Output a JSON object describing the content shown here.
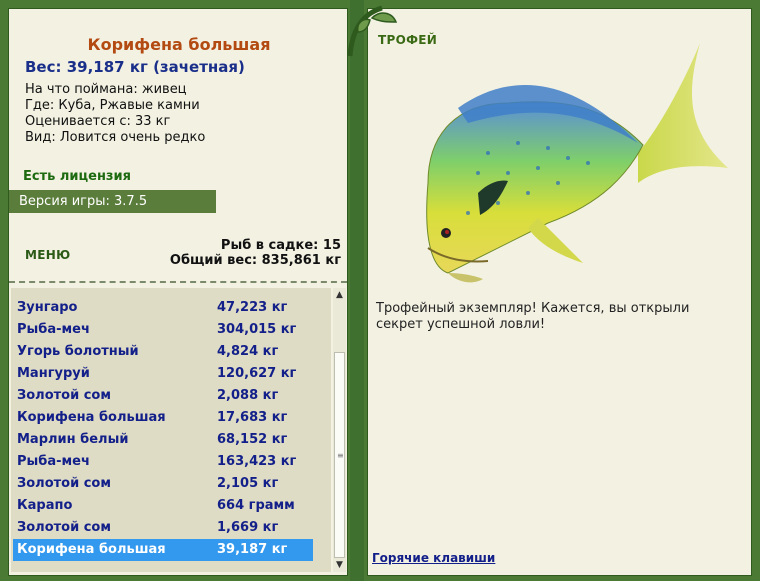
{
  "fish": {
    "title": "Корифена большая",
    "weight_line": "Вес: 39,187 кг (зачетная)",
    "bait": "На что поймана: живец",
    "location": "Где: Куба, Ржавые камни",
    "valued_from": "Оценивается с: 33 кг",
    "kind": "Вид: Ловится очень редко"
  },
  "license": "Есть лицензия",
  "version": "Версия игры: 3.7.5",
  "menu_label": "МЕНЮ",
  "stats": {
    "fish_in_cage": "Рыб в садке: 15",
    "total_weight": "Общий вес: 835,861 кг"
  },
  "catch_list": [
    {
      "name": "Зунгаро",
      "weight": "47,223 кг"
    },
    {
      "name": "Рыба-меч",
      "weight": "304,015 кг"
    },
    {
      "name": "Угорь болотный",
      "weight": "4,824 кг"
    },
    {
      "name": "Мангуруй",
      "weight": "120,627 кг"
    },
    {
      "name": "Золотой сом",
      "weight": "2,088 кг"
    },
    {
      "name": "Корифена большая",
      "weight": "17,683 кг"
    },
    {
      "name": "Марлин белый",
      "weight": "68,152 кг"
    },
    {
      "name": "Рыба-меч",
      "weight": "163,423 кг"
    },
    {
      "name": "Золотой сом",
      "weight": "2,105 кг"
    },
    {
      "name": "Карапо",
      "weight": "664 грамм"
    },
    {
      "name": "Золотой сом",
      "weight": "1,669 кг"
    },
    {
      "name": "Корифена большая",
      "weight": "39,187 кг"
    }
  ],
  "selected_index": 11,
  "trophy": {
    "label": "ТРОФЕЙ",
    "text": "Трофейный экземпляр! Кажется, вы открыли секрет успешной ловли!"
  },
  "hotkeys_label": "Горячие клавиши",
  "colors": {
    "title": "#b34a12",
    "list_text": "#14208a",
    "selected": "#3399ee"
  }
}
